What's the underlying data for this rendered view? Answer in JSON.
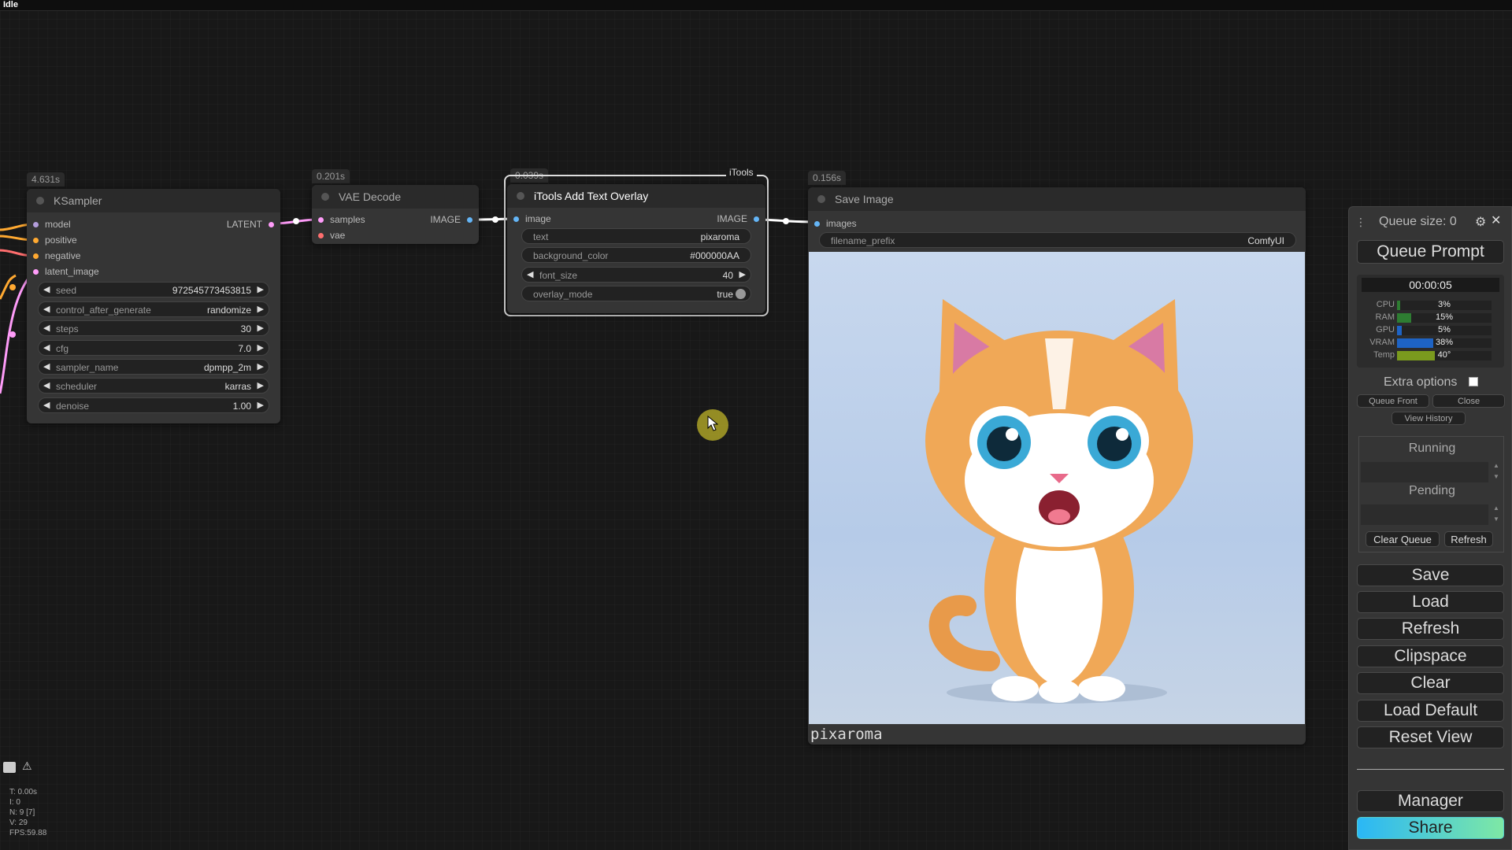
{
  "app": {
    "status": "Idle"
  },
  "colors": {
    "model": "#b39ddb",
    "conditioning": "#ffa931",
    "latent": "#ff9cf9",
    "vae": "#ff6e6e",
    "image": "#64b5f6",
    "share_gradient_start": "#2ab7f6",
    "share_gradient_end": "#7ee8a5"
  },
  "nodes": {
    "ksampler": {
      "time": "4.631s",
      "title": "KSampler",
      "inputs": [
        "model",
        "positive",
        "negative",
        "latent_image"
      ],
      "output": "LATENT",
      "widgets": [
        {
          "label": "seed",
          "value": "972545773453815"
        },
        {
          "label": "control_after_generate",
          "value": "randomize"
        },
        {
          "label": "steps",
          "value": "30"
        },
        {
          "label": "cfg",
          "value": "7.0"
        },
        {
          "label": "sampler_name",
          "value": "dpmpp_2m"
        },
        {
          "label": "scheduler",
          "value": "karras"
        },
        {
          "label": "denoise",
          "value": "1.00"
        }
      ]
    },
    "vae_decode": {
      "time": "0.201s",
      "title": "VAE Decode",
      "inputs": [
        "samples",
        "vae"
      ],
      "output": "IMAGE"
    },
    "text_overlay": {
      "time": "0.039s",
      "group": "iTools",
      "title": "iTools Add Text Overlay",
      "input": "image",
      "output": "IMAGE",
      "widgets": [
        {
          "label": "text",
          "value": "pixaroma"
        },
        {
          "label": "background_color",
          "value": "#000000AA"
        },
        {
          "label": "font_size",
          "value": "40"
        },
        {
          "label": "overlay_mode",
          "value": "true"
        }
      ]
    },
    "save_image": {
      "time": "0.156s",
      "title": "Save Image",
      "input": "images",
      "filename_prefix_label": "filename_prefix",
      "filename_prefix_value": "ComfyUI",
      "caption": "pixaroma"
    }
  },
  "panel": {
    "queue_size": "Queue size: 0",
    "queue_prompt": "Queue Prompt",
    "timer": "00:00:05",
    "monitors": [
      {
        "label": "CPU",
        "value": "3%",
        "percent": 3,
        "color": "#2e7d32"
      },
      {
        "label": "RAM",
        "value": "15%",
        "percent": 15,
        "color": "#2e7d32"
      },
      {
        "label": "GPU",
        "value": "5%",
        "percent": 5,
        "color": "#1e63c4"
      },
      {
        "label": "VRAM",
        "value": "38%",
        "percent": 38,
        "color": "#1e63c4"
      },
      {
        "label": "Temp",
        "value": "40°",
        "percent": 40,
        "color": "#7a9a1e"
      }
    ],
    "extra_options": "Extra options",
    "queue_front": "Queue Front",
    "close": "Close",
    "view_history": "View History",
    "running": "Running",
    "pending": "Pending",
    "clear_queue": "Clear Queue",
    "refresh_small": "Refresh",
    "buttons": [
      "Save",
      "Load",
      "Refresh",
      "Clipspace",
      "Clear",
      "Load Default",
      "Reset View"
    ],
    "manager": "Manager",
    "share": "Share"
  },
  "stats": [
    "T: 0.00s",
    "I: 0",
    "N: 9 [7]",
    "V: 29",
    "FPS:59.88"
  ]
}
